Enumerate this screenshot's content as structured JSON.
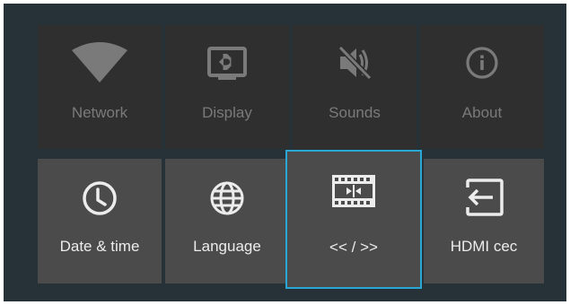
{
  "colors": {
    "background": "#263238",
    "tile_inactive": "#2f2f2f",
    "tile_active": "#4b4b4b",
    "focus_border": "#29a8d6",
    "text_inactive": "#7a7a7a",
    "text_active": "#ececec"
  },
  "top_row": [
    {
      "label": "Network",
      "icon": "wifi-icon"
    },
    {
      "label": "Display",
      "icon": "display-brightness-icon"
    },
    {
      "label": "Sounds",
      "icon": "volume-off-icon"
    },
    {
      "label": "About",
      "icon": "info-icon"
    }
  ],
  "bottom_row": [
    {
      "label": "Date & time",
      "icon": "clock-icon"
    },
    {
      "label": "Language",
      "icon": "globe-icon"
    },
    {
      "label": "<< / >>",
      "icon": "film-strip-seek-icon",
      "focused": true
    },
    {
      "label": "HDMI cec",
      "icon": "input-hdmi-icon"
    }
  ]
}
